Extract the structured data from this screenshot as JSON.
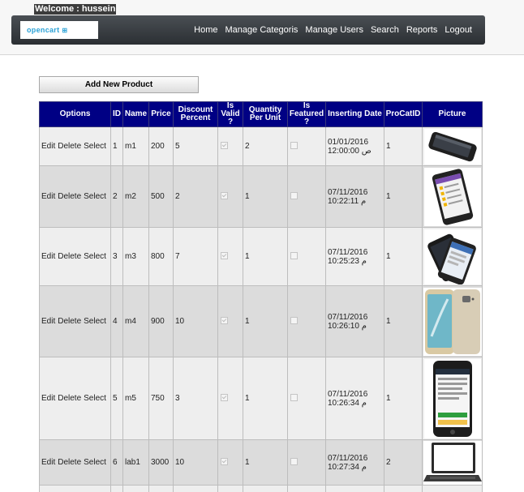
{
  "welcome": "Welcome : hussein",
  "logo": {
    "text": "opencart",
    "cart_glyph": "⊞"
  },
  "nav": {
    "items": [
      "Home",
      "Manage Categoris",
      "Manage Users",
      "Search",
      "Reports",
      "Logout"
    ]
  },
  "add_button": "Add New Product",
  "table": {
    "headers": [
      "Options",
      "ID",
      "Name",
      "Price",
      "Discount Percent",
      "Is Valid ?",
      "Quantity Per Unit",
      "Is Featured ?",
      "Inserting Date",
      "ProCatID",
      "Picture"
    ],
    "rows": [
      {
        "edit": "Edit",
        "delete": "Delete",
        "select": "Select",
        "id": "1",
        "name": "m1",
        "price": "200",
        "discount": "5",
        "valid": true,
        "qty": "2",
        "featured": false,
        "date": "01/01/2016 12:00:00 ص",
        "cat": "1",
        "picture": "black-phone-side"
      },
      {
        "edit": "Edit",
        "delete": "Delete",
        "select": "Select",
        "id": "2",
        "name": "m2",
        "price": "500",
        "discount": "2",
        "valid": true,
        "qty": "1",
        "featured": false,
        "date": "07/11/2016 10:22:11 م",
        "cat": "1",
        "picture": "android-phone"
      },
      {
        "edit": "Edit",
        "delete": "Delete",
        "select": "Select",
        "id": "3",
        "name": "m3",
        "price": "800",
        "discount": "7",
        "valid": true,
        "qty": "1",
        "featured": false,
        "date": "07/11/2016 10:25:23 م",
        "cat": "1",
        "picture": "phone-pair"
      },
      {
        "edit": "Edit",
        "delete": "Delete",
        "select": "Select",
        "id": "4",
        "name": "m4",
        "price": "900",
        "discount": "10",
        "valid": true,
        "qty": "1",
        "featured": false,
        "date": "07/11/2016 10:26:10 م",
        "cat": "1",
        "picture": "gold-phone-front-back"
      },
      {
        "edit": "Edit",
        "delete": "Delete",
        "select": "Select",
        "id": "5",
        "name": "m5",
        "price": "750",
        "discount": "3",
        "valid": true,
        "qty": "1",
        "featured": false,
        "date": "07/11/2016 10:26:34 م",
        "cat": "1",
        "picture": "iphone-store-page"
      },
      {
        "edit": "Edit",
        "delete": "Delete",
        "select": "Select",
        "id": "6",
        "name": "lab1",
        "price": "3000",
        "discount": "10",
        "valid": true,
        "qty": "1",
        "featured": false,
        "date": "07/11/2016 10:27:34 م",
        "cat": "2",
        "picture": "laptop"
      }
    ]
  }
}
